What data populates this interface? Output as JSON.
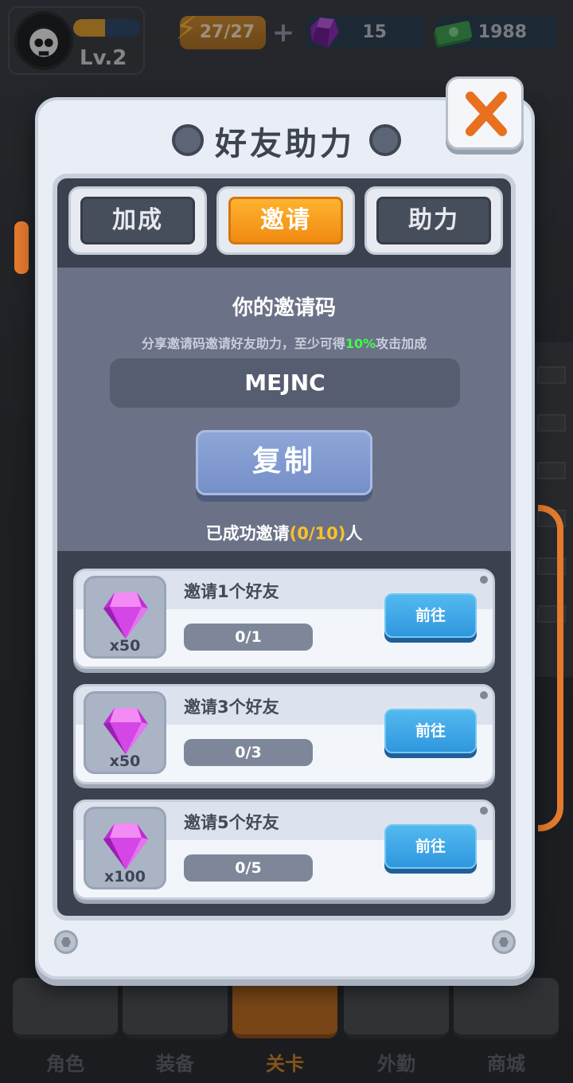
{
  "hud": {
    "level": "Lv.2",
    "energy": "27/27",
    "gems": "15",
    "cash": "1988"
  },
  "modal": {
    "title": "好友助力",
    "tabs": [
      "加成",
      "邀请",
      "助力"
    ],
    "code_title": "你的邀请码",
    "code_sub_before": "分享邀请码邀请好友助力，至少可得",
    "code_sub_highlight": "10%",
    "code_sub_after": "攻击加成",
    "code": "MEJNC",
    "copy_label": "复制",
    "invited_before": "已成功邀请",
    "invited_count": "(0/10)",
    "invited_after": "人",
    "rewards": [
      {
        "label": "邀请1个好友",
        "qty": "x50",
        "progress": "0/1",
        "button": "前往"
      },
      {
        "label": "邀请3个好友",
        "qty": "x50",
        "progress": "0/3",
        "button": "前往"
      },
      {
        "label": "邀请5个好友",
        "qty": "x100",
        "progress": "0/5",
        "button": "前往"
      }
    ]
  },
  "nav": [
    "角色",
    "装备",
    "关卡",
    "外勤",
    "商城"
  ],
  "colors": {
    "accent_orange": "#f08a12",
    "highlight_green": "#3fff4a",
    "highlight_gold": "#ffbf2a",
    "button_blue": "#2f97de"
  },
  "icons": {
    "energy": "battery-bolt-icon",
    "gem": "purple-gem-icon",
    "cash": "cash-stack-icon",
    "close": "close-icon",
    "reward": "pink-diamond-icon"
  }
}
